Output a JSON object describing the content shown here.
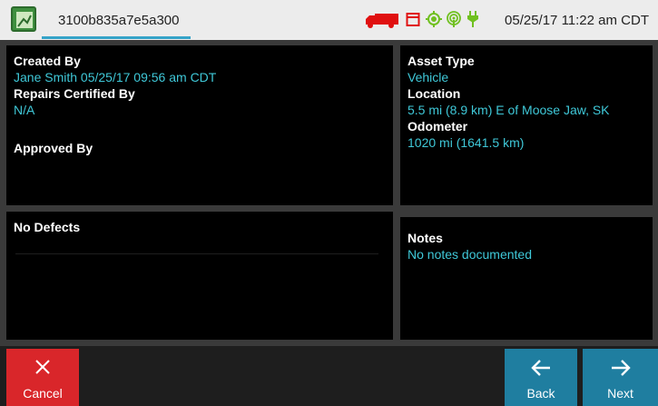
{
  "header": {
    "title": "3100b835a7e5a300",
    "datetime": "05/25/17 11:22 am CDT",
    "status_icons": [
      "truck-icon",
      "trailer-icon",
      "gps-icon",
      "signal-icon",
      "power-plug-icon"
    ],
    "colors": {
      "truck": "#e01010",
      "gps": "#70c020",
      "accent": "#35a3c8"
    }
  },
  "inspection": {
    "created_by_label": "Created By",
    "created_by_value": "Jane Smith 05/25/17 09:56 am CDT",
    "repairs_label": "Repairs Certified By",
    "repairs_value": "N/A",
    "approved_label": "Approved By"
  },
  "asset": {
    "type_label": "Asset Type",
    "type_value": "Vehicle",
    "location_label": "Location",
    "location_value": "5.5 mi (8.9 km) E of Moose Jaw, SK",
    "odometer_label": "Odometer",
    "odometer_value": "1020 mi (1641.5 km)"
  },
  "defects": {
    "label": "No Defects"
  },
  "notes": {
    "label": "Notes",
    "value": "No notes documented"
  },
  "footer": {
    "cancel_label": "Cancel",
    "back_label": "Back",
    "next_label": "Next"
  }
}
